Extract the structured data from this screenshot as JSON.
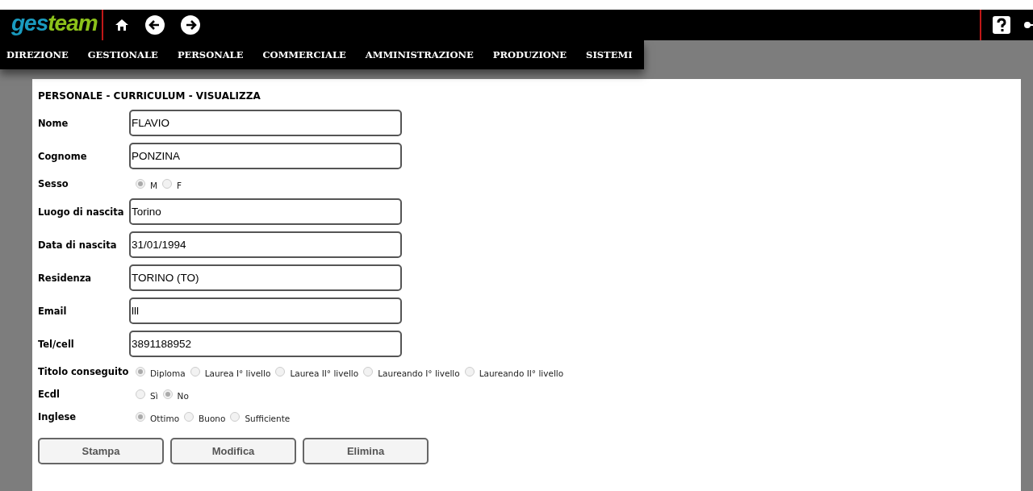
{
  "header": {
    "logo_left": "ges",
    "logo_right": "team"
  },
  "menu": [
    {
      "label": "DIREZIONE"
    },
    {
      "label": "GESTIONALE"
    },
    {
      "label": "PERSONALE"
    },
    {
      "label": "COMMERCIALE"
    },
    {
      "label": "AMMINISTRAZIONE"
    },
    {
      "label": "PRODUZIONE"
    },
    {
      "label": "SISTEMI"
    }
  ],
  "page_title": "PERSONALE - CURRICULUM - VISUALIZZA",
  "fields": [
    {
      "kind": "text",
      "label": "Nome",
      "value": "FLAVIO"
    },
    {
      "kind": "text",
      "label": "Cognome",
      "value": "PONZINA"
    },
    {
      "kind": "radio",
      "label": "Sesso",
      "options": [
        {
          "label": "M",
          "selected": true
        },
        {
          "label": "F",
          "selected": false
        }
      ]
    },
    {
      "kind": "text",
      "label": "Luogo di nascita",
      "value": "Torino"
    },
    {
      "kind": "text",
      "label": "Data di nascita",
      "value": "31/01/1994"
    },
    {
      "kind": "text",
      "label": "Residenza",
      "value": "TORINO (TO)"
    },
    {
      "kind": "text",
      "label": "Email",
      "value": "lll"
    },
    {
      "kind": "text",
      "label": "Tel/cell",
      "value": "3891188952"
    },
    {
      "kind": "radio",
      "label": "Titolo conseguito",
      "options": [
        {
          "label": "Diploma",
          "selected": true
        },
        {
          "label": "Laurea I° livello",
          "selected": false
        },
        {
          "label": "Laurea II° livello",
          "selected": false
        },
        {
          "label": "Laureando I° livello",
          "selected": false
        },
        {
          "label": "Laureando II° livello",
          "selected": false
        }
      ]
    },
    {
      "kind": "radio",
      "label": "Ecdl",
      "options": [
        {
          "label": "Sì",
          "selected": false
        },
        {
          "label": "No",
          "selected": true
        }
      ]
    },
    {
      "kind": "radio",
      "label": "Inglese",
      "options": [
        {
          "label": "Ottimo",
          "selected": true
        },
        {
          "label": "Buono",
          "selected": false
        },
        {
          "label": "Sufficiente",
          "selected": false
        }
      ]
    }
  ],
  "buttons": [
    "Stampa",
    "Modifica",
    "Elimina"
  ]
}
